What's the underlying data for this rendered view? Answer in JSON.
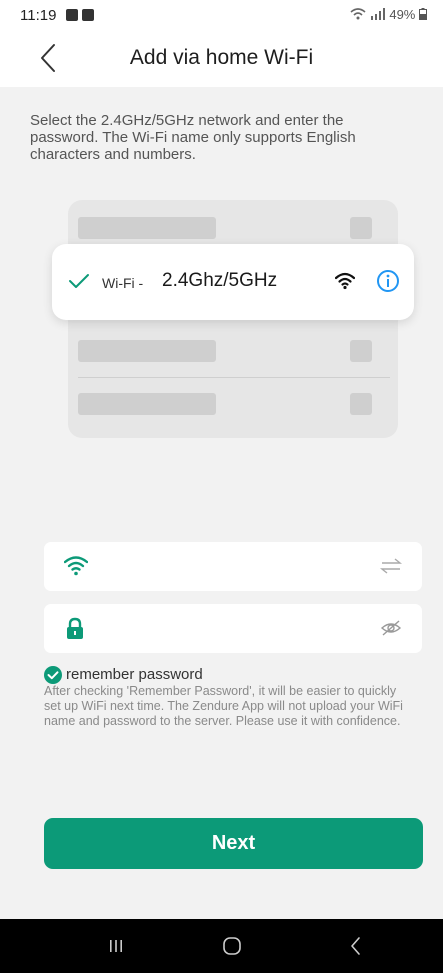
{
  "status_bar": {
    "time": "11:19",
    "battery": "49%"
  },
  "header": {
    "title": "Add via home Wi-Fi",
    "back_icon": "chevron-left-icon"
  },
  "instructions": "Select the 2.4GHz/5GHz network and enter the password. The Wi-Fi name only supports English characters and numbers.",
  "illustration": {
    "wifi_prefix": "Wi-Fi -",
    "wifi_band": "2.4Ghz/5GHz",
    "icons": [
      "check-icon",
      "wifi-icon",
      "info-icon"
    ]
  },
  "form": {
    "wifi_field": {
      "value": "",
      "placeholder": "",
      "left_icon": "wifi-icon",
      "right_icon": "swap-icon"
    },
    "password_field": {
      "value": "",
      "placeholder": "",
      "left_icon": "lock-icon",
      "right_icon": "eye-off-icon"
    },
    "remember": {
      "label": "remember password",
      "checked": true,
      "hint": "After checking 'Remember Password', it will be easier to quickly set up WiFi next time. The Zendure App will not upload your WiFi name and password to the server. Please use it with confidence."
    }
  },
  "next_label": "Next",
  "colors": {
    "accent": "#0c9a78",
    "info_blue": "#2196f3",
    "background": "#f2f2f2"
  }
}
